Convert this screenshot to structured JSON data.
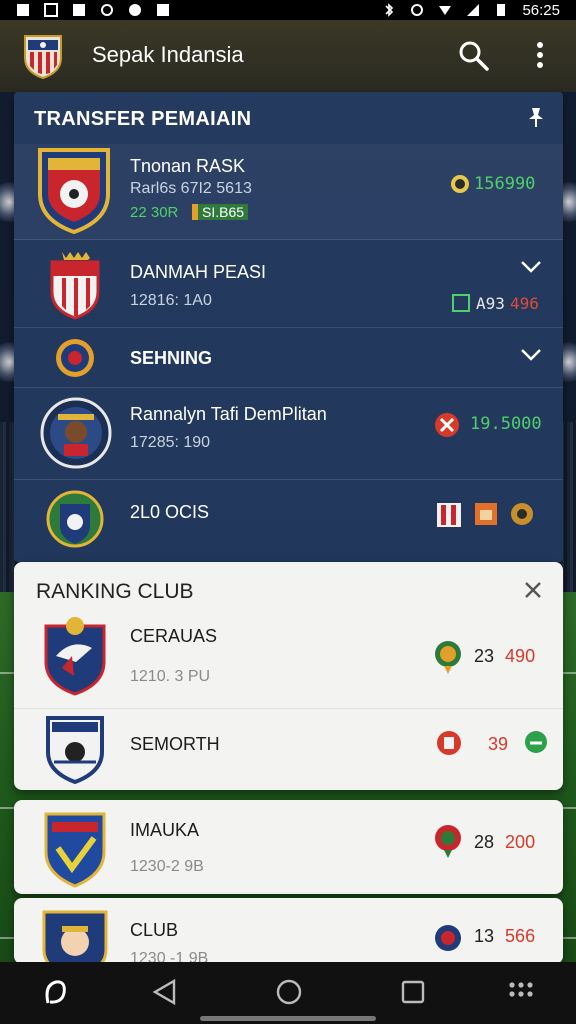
{
  "status_bar": {
    "time": "56:25"
  },
  "app_bar": {
    "title": "Sepak Indansia"
  },
  "transfer_panel": {
    "title": "TRANSFER PEMAIAIN",
    "rows": [
      {
        "name": "Tnonan RASK",
        "sub": "Rarl6s 67I2 5613",
        "tag_num": "22 30R",
        "tag_badge": "SI.B65",
        "value": "156990"
      },
      {
        "name": "DANMAH PEASI",
        "sub": "12816: 1A0",
        "value": "A93",
        "value_red": "496"
      },
      {
        "name": "SEHNING"
      },
      {
        "name": "Rannalyn Tafi DemPlitan",
        "sub": "17285: 190",
        "value": "19.5000"
      },
      {
        "name": "2L0 OCIS"
      }
    ]
  },
  "ranking_panel": {
    "title": "RANKING CLUB",
    "rows": [
      {
        "name": "CERAUAS",
        "sub": "1210. 3 PU",
        "rank": "23",
        "points": "490"
      },
      {
        "name": "SEMORTH",
        "rank": "39"
      }
    ]
  },
  "cards": [
    {
      "name": "IMAUKA",
      "sub": "1230-2 9B",
      "rank": "28",
      "points": "200"
    },
    {
      "name": "CLUB",
      "sub": "1230 -1 9B",
      "rank": "13",
      "points": "566"
    }
  ],
  "colors": {
    "accent_green": "#4fd06a",
    "accent_red": "#d53a2a",
    "panel_blue": "#233a5e"
  }
}
